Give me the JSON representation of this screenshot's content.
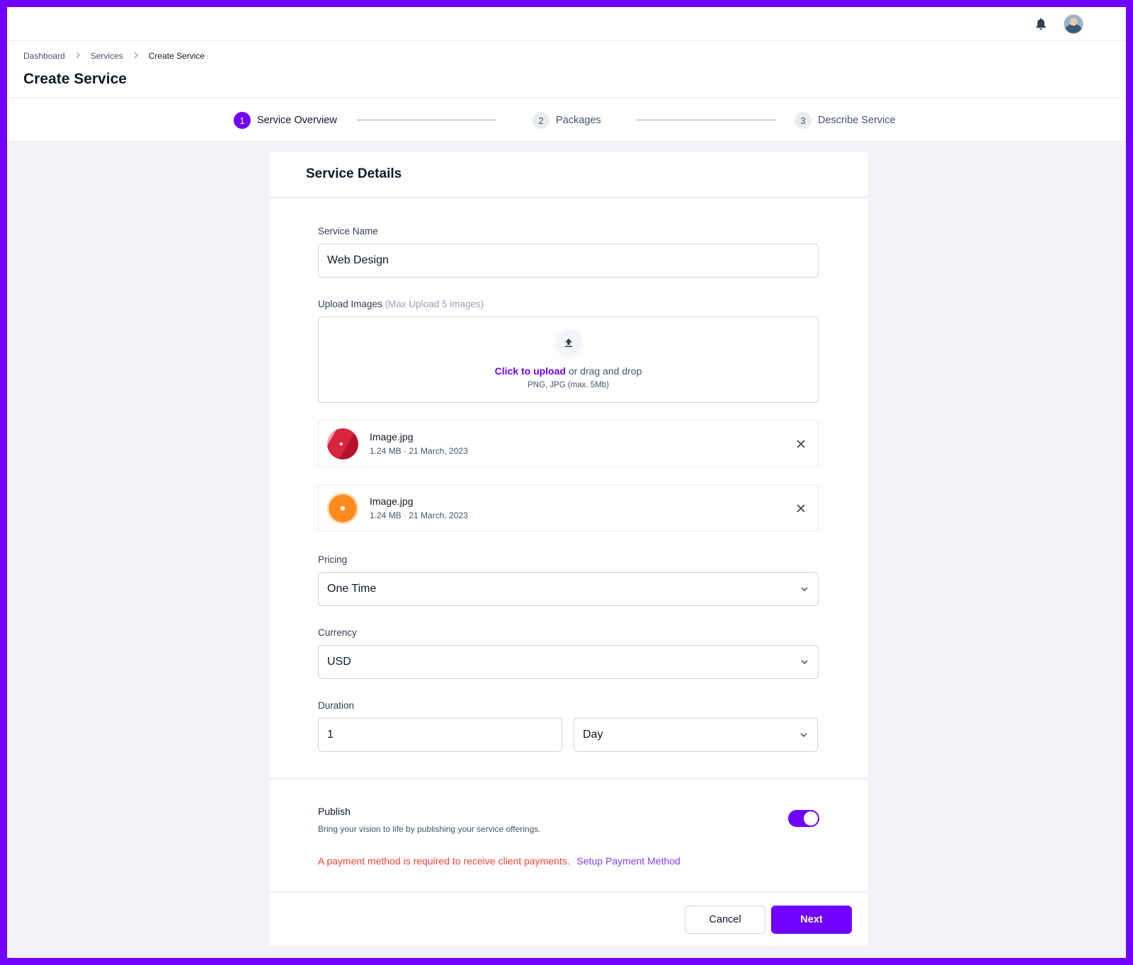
{
  "topbar": {
    "notification_icon": "bell-icon",
    "avatar_icon": "user-avatar"
  },
  "breadcrumb": {
    "items": [
      "Dashboard",
      "Services",
      "Create Service"
    ]
  },
  "page": {
    "title": "Create Service"
  },
  "stepper": {
    "steps": [
      {
        "num": "1",
        "label": "Service Overview",
        "active": true
      },
      {
        "num": "2",
        "label": "Packages",
        "active": false
      },
      {
        "num": "3",
        "label": "Describe Service",
        "active": false
      }
    ]
  },
  "card": {
    "title": "Service Details",
    "service_name": {
      "label": "Service Name",
      "value": "Web Design"
    },
    "upload": {
      "label": "Upload Images",
      "hint": "(Max Upload 5 images)",
      "link": "Click to upload",
      "text": "or drag and drop",
      "sub": "PNG, JPG  (max. 5Mb)",
      "icon": "upload-icon"
    },
    "files": [
      {
        "name": "Image.jpg",
        "meta": "1.24 MB · 21 March, 2023"
      },
      {
        "name": "Image.jpg",
        "meta": "1.24 MB · 21 March, 2023"
      }
    ],
    "pricing": {
      "label": "Pricing",
      "value": "One Time"
    },
    "currency": {
      "label": "Currency",
      "value": "USD"
    },
    "duration": {
      "label": "Duration",
      "amount": "1",
      "unit": "Day"
    }
  },
  "publish": {
    "title": "Publish",
    "desc": "Bring your vision to life by publishing your service offerings.",
    "enabled": true,
    "warning": "A payment method is required to receive client payments.",
    "link": "Setup Payment Method"
  },
  "footer": {
    "cancel": "Cancel",
    "next": "Next"
  },
  "colors": {
    "accent": "#7000ff",
    "error": "#f04438",
    "link": "#7f3fff"
  }
}
